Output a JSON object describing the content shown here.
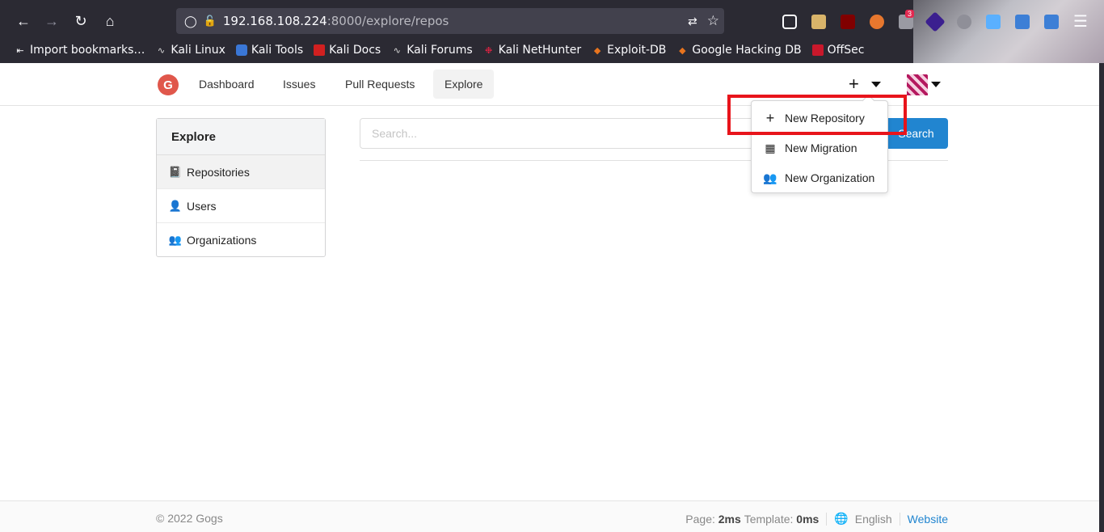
{
  "browser": {
    "url_host": "192.168.108.224",
    "url_rest": ":8000/explore/repos",
    "extension_badge": "3",
    "bookmarks": [
      {
        "label": "Import bookmarks…",
        "icon": "import-icon"
      },
      {
        "label": "Kali Linux",
        "icon": "kali-dragon-icon"
      },
      {
        "label": "Kali Tools",
        "icon": "kali-tools-icon"
      },
      {
        "label": "Kali Docs",
        "icon": "kali-docs-icon"
      },
      {
        "label": "Kali Forums",
        "icon": "kali-dragon-icon"
      },
      {
        "label": "Kali NetHunter",
        "icon": "nethunter-icon"
      },
      {
        "label": "Exploit-DB",
        "icon": "exploit-db-icon"
      },
      {
        "label": "Google Hacking DB",
        "icon": "ghdb-icon"
      },
      {
        "label": "OffSec",
        "icon": "offsec-icon"
      }
    ]
  },
  "header": {
    "menu": [
      "Dashboard",
      "Issues",
      "Pull Requests",
      "Explore"
    ],
    "active": "Explore"
  },
  "sidebar": {
    "title": "Explore",
    "items": [
      {
        "label": "Repositories",
        "icon": "repo-icon"
      },
      {
        "label": "Users",
        "icon": "user-icon"
      },
      {
        "label": "Organizations",
        "icon": "organization-icon"
      }
    ]
  },
  "search": {
    "placeholder": "Search...",
    "button": "Search"
  },
  "create_menu": {
    "items": [
      {
        "label": "New Repository",
        "icon": "plus-icon"
      },
      {
        "label": "New Migration",
        "icon": "migration-icon"
      },
      {
        "label": "New Organization",
        "icon": "organization-icon"
      }
    ]
  },
  "footer": {
    "copyright": "© 2022 Gogs",
    "page_label": "Page:",
    "page_time": "2ms",
    "template_label": "Template:",
    "template_time": "0ms",
    "language": "English",
    "website": "Website"
  },
  "colors": {
    "accent": "#2185d0",
    "highlight": "#e8141b",
    "logo": "#e0574b"
  }
}
